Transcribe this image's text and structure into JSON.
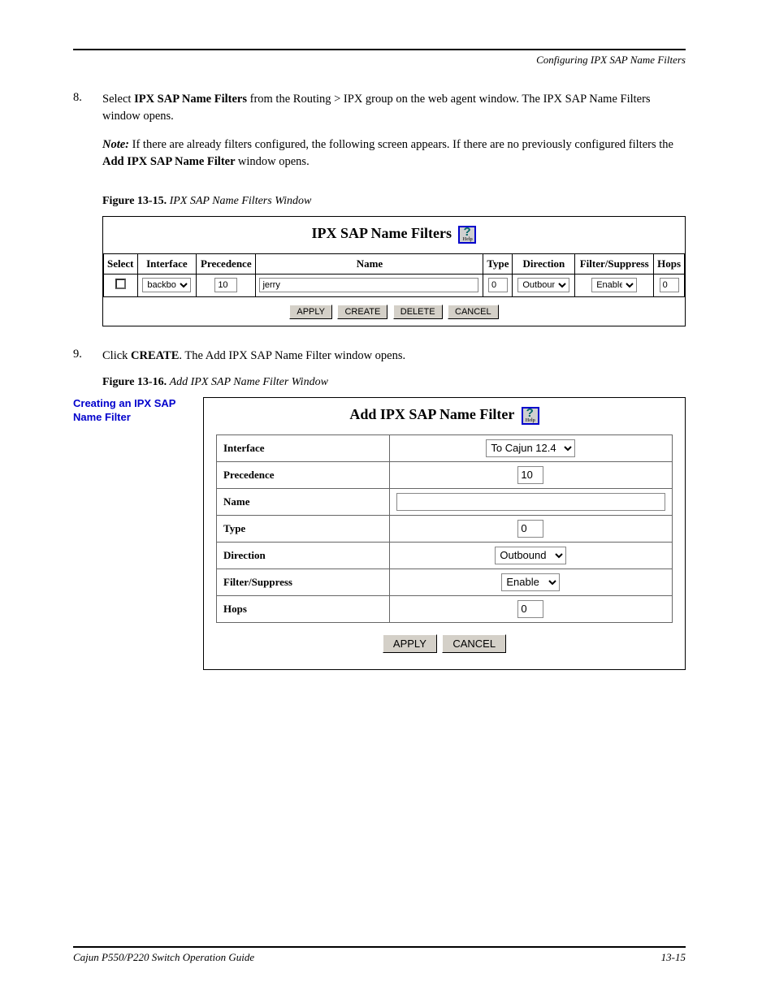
{
  "header": "Configuring IPX SAP Name Filters",
  "section_no": "8.",
  "section_text_a": "Select ",
  "section_bold": "IPX SAP Name Filters",
  "section_text_b": " from the Routing > IPX group on the web agent window. The IPX SAP Name Filters window opens.",
  "note_label": "Note: ",
  "note_text": "If there are already filters configured, the following screen appears. If there are no previously configured filters the ",
  "note_bold2": "Add IPX SAP Name Filter ",
  "note_text2": "window opens.",
  "fig1_label": "Figure 13-15. ",
  "fig1_title": "IPX SAP Name Filters Window",
  "shot1": {
    "title": "IPX SAP Name Filters",
    "headers": [
      "Select",
      "Interface",
      "Precedence",
      "Name",
      "Type",
      "Direction",
      "Filter/Suppress",
      "Hops"
    ],
    "row": {
      "interface": "backbone",
      "precedence": "10",
      "name": "jerry",
      "type": "0",
      "direction": "Outbound",
      "filter_suppress": "Enable",
      "hops": "0"
    },
    "buttons": [
      "APPLY",
      "CREATE",
      "DELETE",
      "CANCEL"
    ]
  },
  "step9_no": "9.",
  "step9_a": "Click ",
  "step9_bold": "CREATE",
  "step9_b": ". The Add IPX SAP Name Filter window opens.",
  "fig2_label": "Figure 13-16. ",
  "fig2_title": "Add IPX SAP Name Filter Window",
  "side_label": "Creating an IPX SAP Name Filter",
  "shot2": {
    "title": "Add IPX SAP Name Filter",
    "rows": [
      {
        "label": "Interface",
        "type": "select",
        "value": "To Cajun 12.4"
      },
      {
        "label": "Precedence",
        "type": "input",
        "value": "10"
      },
      {
        "label": "Name",
        "type": "input",
        "value": ""
      },
      {
        "label": "Type",
        "type": "input",
        "value": "0"
      },
      {
        "label": "Direction",
        "type": "select",
        "value": "Outbound"
      },
      {
        "label": "Filter/Suppress",
        "type": "select",
        "value": "Enable"
      },
      {
        "label": "Hops",
        "type": "input",
        "value": "0"
      }
    ],
    "buttons": [
      "APPLY",
      "CANCEL"
    ]
  },
  "footer_left": "Cajun P550/P220 Switch Operation Guide",
  "footer_right": "13-15"
}
